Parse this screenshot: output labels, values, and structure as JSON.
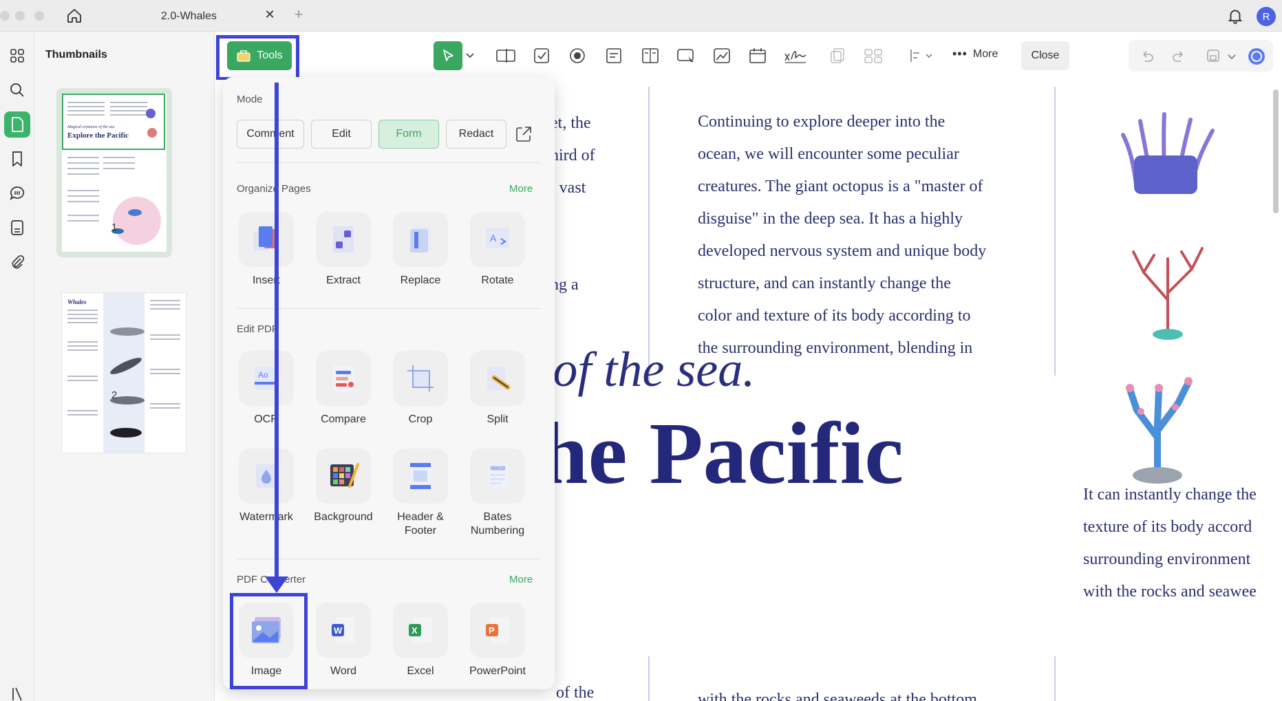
{
  "tab": {
    "title": "2.0-Whales"
  },
  "user": {
    "avatar_initial": "R"
  },
  "thumbnails": {
    "title": "Thumbnails",
    "pages": [
      {
        "number": "1",
        "heading_small": "Magical creatures of the sea",
        "heading": "Explore the Pacific"
      },
      {
        "number": "2",
        "heading": "Whales"
      }
    ]
  },
  "toolbar": {
    "tools_label": "Tools",
    "more_label": "More",
    "close_label": "Close"
  },
  "popup": {
    "mode": {
      "label": "Mode",
      "buttons": [
        "Comment",
        "Edit",
        "Form",
        "Redact"
      ],
      "active": "Form"
    },
    "organize": {
      "label": "Organize Pages",
      "more": "More",
      "tools": [
        "Insert",
        "Extract",
        "Replace",
        "Rotate"
      ]
    },
    "edit": {
      "label": "Edit PDF",
      "tools": [
        "OCR",
        "Compare",
        "Crop",
        "Split",
        "Watermark",
        "Background",
        "Header & Footer",
        "Bates Numbering"
      ]
    },
    "converter": {
      "label": "PDF Converter",
      "more": "More",
      "tools": [
        "Image",
        "Word",
        "Excel",
        "PowerPoint"
      ]
    }
  },
  "document": {
    "col1_lines": [
      "et, the",
      "hird of",
      "l vast",
      "",
      "",
      "ng a"
    ],
    "col2_lines": [
      "Continuing to explore deeper into the",
      "ocean, we will encounter some peculiar",
      "creatures. The giant octopus is a \"master of",
      "disguise\" in the deep sea. It has a highly",
      "developed nervous system and unique body",
      "structure, and can instantly change the",
      "color and texture of its body according to",
      "the surrounding environment, blending in"
    ],
    "italic_heading": "ures of the sea.",
    "bold_heading": "e the Pacific",
    "right_lines": [
      "It can instantly change the",
      "texture of its body accord",
      "surrounding environment",
      "with the rocks and seawee"
    ],
    "bottom_col1": "of the",
    "bottom_col2": "with the rocks and seaweeds at the bottom"
  },
  "colors": {
    "accent": "#3aa860",
    "annotation": "#3d44d6",
    "doc_text": "#2a2f6e"
  }
}
